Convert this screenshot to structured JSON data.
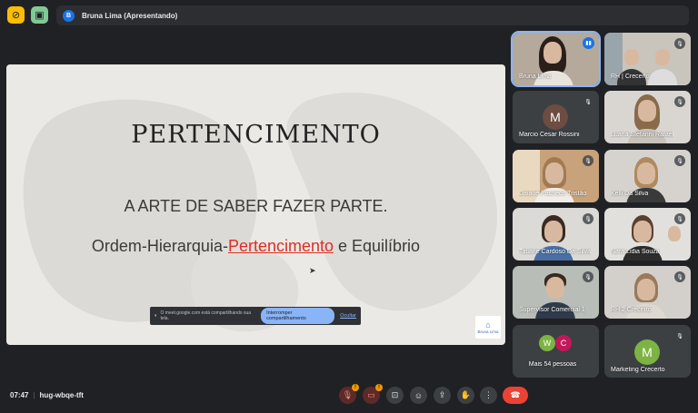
{
  "presenter": {
    "initial": "B",
    "label": "Bruna Lima (Apresentando)"
  },
  "slide": {
    "title": "PERTENCIMENTO",
    "subtitle": "A ARTE DE SABER FAZER PARTE.",
    "line_prefix": "Ordem-Hierarquia-",
    "line_highlight": "Pertencimento",
    "line_suffix": " e Equilíbrio",
    "share_text": "O meet.google.com está compartilhando sua tela.",
    "stop_share": "Interromper compartilhamento",
    "hide": "Ocultar",
    "logo_text": "Bruna Lima"
  },
  "participants": [
    {
      "name": "Bruna Lima",
      "status": "speaking"
    },
    {
      "name": "RH | Crecerto",
      "status": "muted"
    },
    {
      "name": "Marcio Cesar Rossini",
      "status": "muted",
      "initial": "M"
    },
    {
      "name": "Luana Stefanni Rafael",
      "status": "muted"
    },
    {
      "name": "Daiane Pacheco Tristão",
      "status": "muted"
    },
    {
      "name": "Kelli Da Silva",
      "status": "muted"
    },
    {
      "name": "Tatiane Cardoso Da Silva",
      "status": "muted"
    },
    {
      "name": "Nara Lidia Souza",
      "status": "muted"
    },
    {
      "name": "Supervisor Comercial 1",
      "status": "muted"
    },
    {
      "name": "RH 2 Crecerto",
      "status": "muted"
    },
    {
      "name": "Mais 54 pessoas",
      "initials": [
        "W",
        "C"
      ]
    },
    {
      "name": "Marketing Crecerto",
      "status": "muted",
      "initial": "M"
    }
  ],
  "meeting": {
    "time": "07:47",
    "code": "hug-wbqe-tft"
  },
  "colors": {
    "accent": "#8ab4f8",
    "hangup": "#ea4335",
    "highlight": "#d93025"
  }
}
